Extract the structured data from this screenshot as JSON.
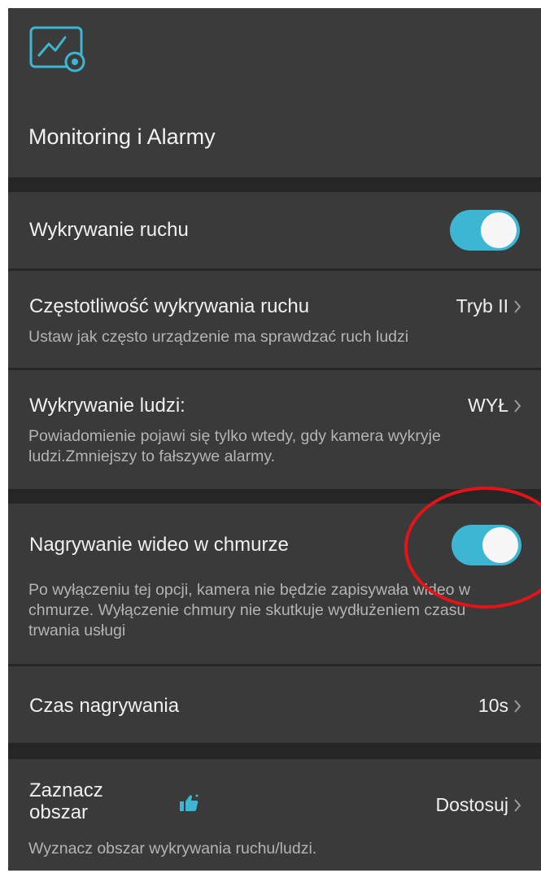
{
  "page": {
    "title": "Monitoring i Alarmy"
  },
  "settings": {
    "motion_detection": {
      "label": "Wykrywanie ruchu",
      "enabled": true
    },
    "motion_frequency": {
      "label": "Częstotliwość wykrywania ruchu",
      "value": "Tryb II",
      "description": "Ustaw jak często urządzenie ma sprawdzać ruch ludzi"
    },
    "human_detection": {
      "label": "Wykrywanie ludzi:",
      "value": "WYŁ",
      "description": "Powiadomienie pojawi się tylko wtedy, gdy kamera wykryje ludzi.Zmniejszy to fałszywe alarmy."
    },
    "cloud_recording": {
      "label": "Nagrywanie wideo w chmurze",
      "enabled": true,
      "description": "Po wyłączeniu tej opcji, kamera nie będzie zapisywała wideo w chmurze. Wyłączenie chmury nie skutkuje wydłużeniem czasu trwania usługi"
    },
    "recording_time": {
      "label": "Czas nagrywania",
      "value": "10s"
    },
    "detection_area": {
      "label": "Zaznacz obszar",
      "value": "Dostosuj",
      "description": "Wyznacz obszar wykrywania ruchu/ludzi.",
      "badge_icon": "thumbs-up-icon"
    }
  },
  "colors": {
    "accent": "#3cb6d3",
    "annotation": "#e2141a",
    "background": "#383838"
  }
}
